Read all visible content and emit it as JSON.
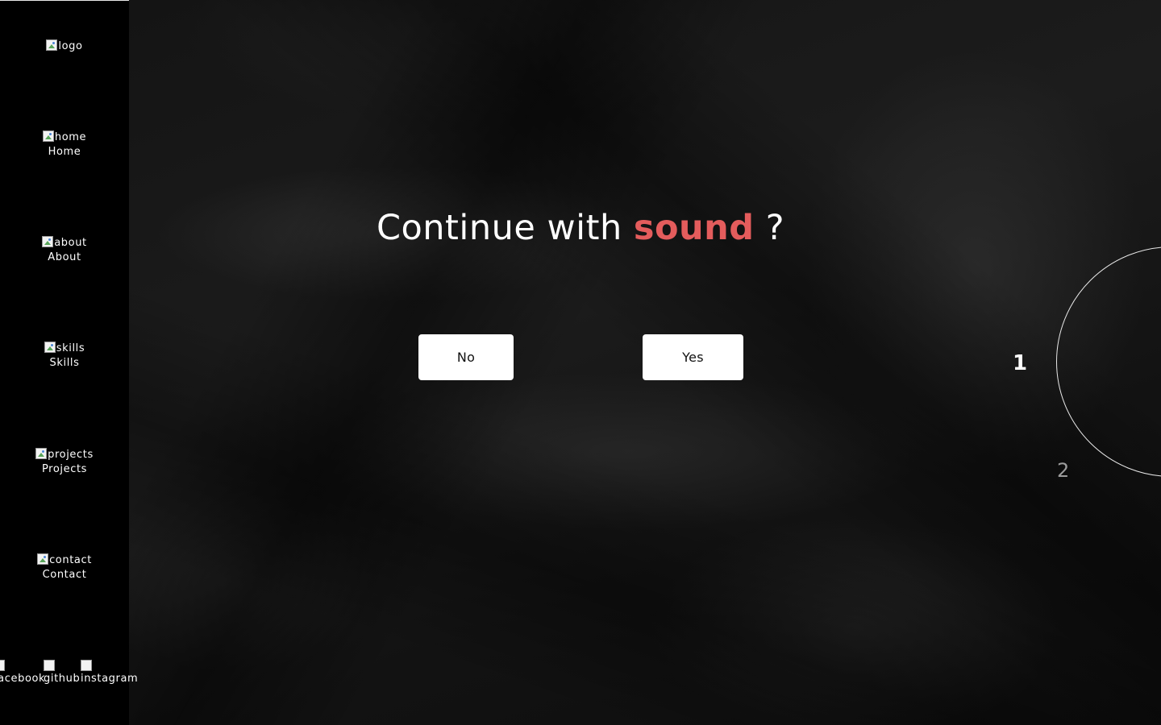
{
  "sidebar": {
    "logo_alt": "logo",
    "items": [
      {
        "icon_alt": "home",
        "label": "Home"
      },
      {
        "icon_alt": "about",
        "label": "About"
      },
      {
        "icon_alt": "skills",
        "label": "Skills"
      },
      {
        "icon_alt": "projects",
        "label": "Projects"
      },
      {
        "icon_alt": "contact",
        "label": "Contact"
      }
    ],
    "socials": [
      {
        "label": "facebook"
      },
      {
        "label": "github"
      },
      {
        "label": "instagram"
      }
    ]
  },
  "dialog": {
    "prefix": "Continue with ",
    "accent_word": "sound",
    "suffix": " ?",
    "accent_color": "#e45c5c",
    "no_label": "No",
    "yes_label": "Yes"
  },
  "pager": {
    "current": "1",
    "next": "2"
  }
}
